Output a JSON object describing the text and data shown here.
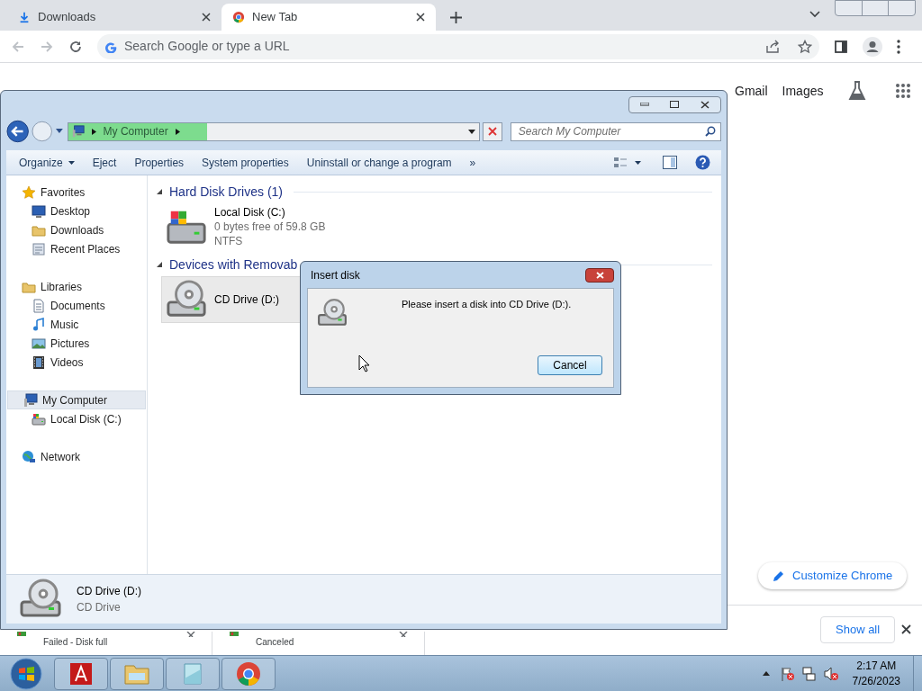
{
  "browser": {
    "tabs": [
      {
        "label": "Downloads",
        "selected": false,
        "kind": "download"
      },
      {
        "label": "New Tab",
        "selected": true,
        "kind": "chrome"
      }
    ],
    "omnibox": {
      "placeholder": "Search Google or type a URL"
    },
    "ntp_links": [
      "Gmail",
      "Images"
    ],
    "customize": "Customize Chrome",
    "downloads": [
      {
        "status": "Failed - Disk full"
      },
      {
        "status": "Canceled"
      }
    ],
    "show_all": "Show all"
  },
  "explorer": {
    "breadcrumb": "My Computer",
    "search": {
      "placeholder": "Search My Computer"
    },
    "toolbar": [
      {
        "label": "Organize",
        "kind": "menu"
      },
      {
        "label": "Eject",
        "kind": "plain"
      },
      {
        "label": "Properties",
        "kind": "plain"
      },
      {
        "label": "System properties",
        "kind": "plain"
      },
      {
        "label": "Uninstall or change a program",
        "kind": "plain"
      },
      {
        "label": "»",
        "kind": "plain"
      }
    ],
    "sidebar": [
      {
        "label": "Favorites",
        "kind": "star",
        "selected": false,
        "children": [
          {
            "label": "Desktop",
            "kind": "desktop",
            "selected": false
          },
          {
            "label": "Downloads",
            "kind": "folder",
            "selected": false
          },
          {
            "label": "Recent Places",
            "kind": "recent",
            "selected": false
          }
        ]
      },
      {
        "label": "Libraries",
        "kind": "folder",
        "selected": false,
        "children": [
          {
            "label": "Documents",
            "kind": "doc",
            "selected": false
          },
          {
            "label": "Music",
            "kind": "music",
            "selected": false
          },
          {
            "label": "Pictures",
            "kind": "picture",
            "selected": false
          },
          {
            "label": "Videos",
            "kind": "video",
            "selected": false
          }
        ]
      },
      {
        "label": "My Computer",
        "kind": "computer",
        "selected": true,
        "children": [
          {
            "label": "Local Disk (C:)",
            "kind": "disk",
            "selected": false
          }
        ]
      },
      {
        "label": "Network",
        "kind": "network",
        "selected": false
      }
    ],
    "sections": [
      {
        "title": "Hard Disk Drives (1)",
        "items": [
          {
            "name": "Local Disk (C:)",
            "kind": "disk",
            "selected": false,
            "lines": [
              "0 bytes free of 59.8 GB",
              "NTFS"
            ]
          }
        ]
      },
      {
        "title": "Devices with Removab",
        "items": [
          {
            "name": "CD Drive (D:)",
            "kind": "cd",
            "selected": true
          }
        ]
      }
    ],
    "details": {
      "name": "CD Drive (D:)",
      "type": "CD Drive"
    }
  },
  "dialog": {
    "title": "Insert disk",
    "message": "Please insert a disk into CD Drive (D:).",
    "button": "Cancel"
  },
  "taskbar": {
    "apps": [
      {
        "kind": "adobe"
      },
      {
        "kind": "explorer"
      },
      {
        "kind": "notepad"
      },
      {
        "kind": "chrome"
      }
    ],
    "time": "2:17 AM",
    "date": "7/26/2023"
  }
}
